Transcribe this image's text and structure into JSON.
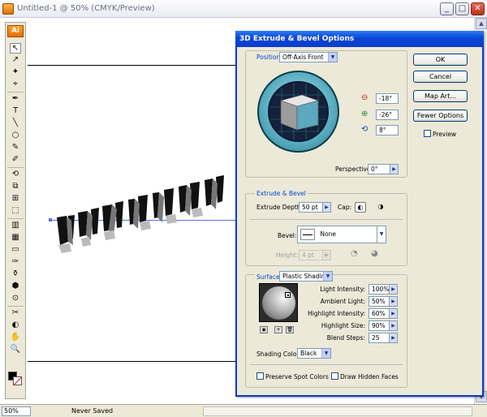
{
  "window": {
    "title": "Untitled-1 @ 50% (CMYK/Preview)",
    "min_label": "_",
    "max_label": "□",
    "close_label": "✕"
  },
  "tools": {
    "logo": "Ai",
    "glyphs": [
      "↖",
      "↗",
      "✦",
      "⌖",
      "✒",
      "T",
      "╲",
      "○",
      "✎",
      "✐",
      "⟲",
      "⧉",
      "⊞",
      "⬚",
      "▥",
      "▦",
      "▭",
      "✑",
      "⚱",
      "⬢",
      "⊙",
      "✂",
      "◐",
      "✋",
      "🔍"
    ]
  },
  "status": {
    "zoom": "50%",
    "text": "Never Saved"
  },
  "dialog": {
    "title": "3D Extrude & Bevel Options",
    "position": {
      "label": "Position:",
      "value": "Off-Axis Front",
      "rot_x": "-18°",
      "rot_y": "-26°",
      "rot_z": "8°",
      "perspective_label": "Perspective:",
      "perspective": "0°"
    },
    "buttons": {
      "ok": "OK",
      "cancel": "Cancel",
      "map_art": "Map Art...",
      "fewer_options": "Fewer Options",
      "preview": "Preview"
    },
    "extrude": {
      "section": "Extrude & Bevel",
      "depth_label": "Extrude Depth:",
      "depth": "50 pt",
      "cap_label": "Cap:",
      "bevel_label": "Bevel:",
      "bevel": "None",
      "height_label": "Height:",
      "height": "4 pt"
    },
    "surface": {
      "label": "Surface:",
      "value": "Plastic Shading",
      "light_intensity_label": "Light Intensity:",
      "light_intensity": "100%",
      "ambient_label": "Ambient Light:",
      "ambient": "50%",
      "highlight_intensity_label": "Highlight Intensity:",
      "highlight_intensity": "60%",
      "highlight_size_label": "Highlight Size:",
      "highlight_size": "90%",
      "blend_steps_label": "Blend Steps:",
      "blend_steps": "25",
      "shading_color_label": "Shading Color:",
      "shading_color": "Black",
      "preserve_spot": "Preserve Spot Colors",
      "draw_hidden": "Draw Hidden Faces"
    }
  },
  "colors": {
    "dialog_bg": "#ece9d8",
    "title_blue": "#0a46d8",
    "label_blue": "#0046d5",
    "cube_face": "#5ba8bf"
  }
}
